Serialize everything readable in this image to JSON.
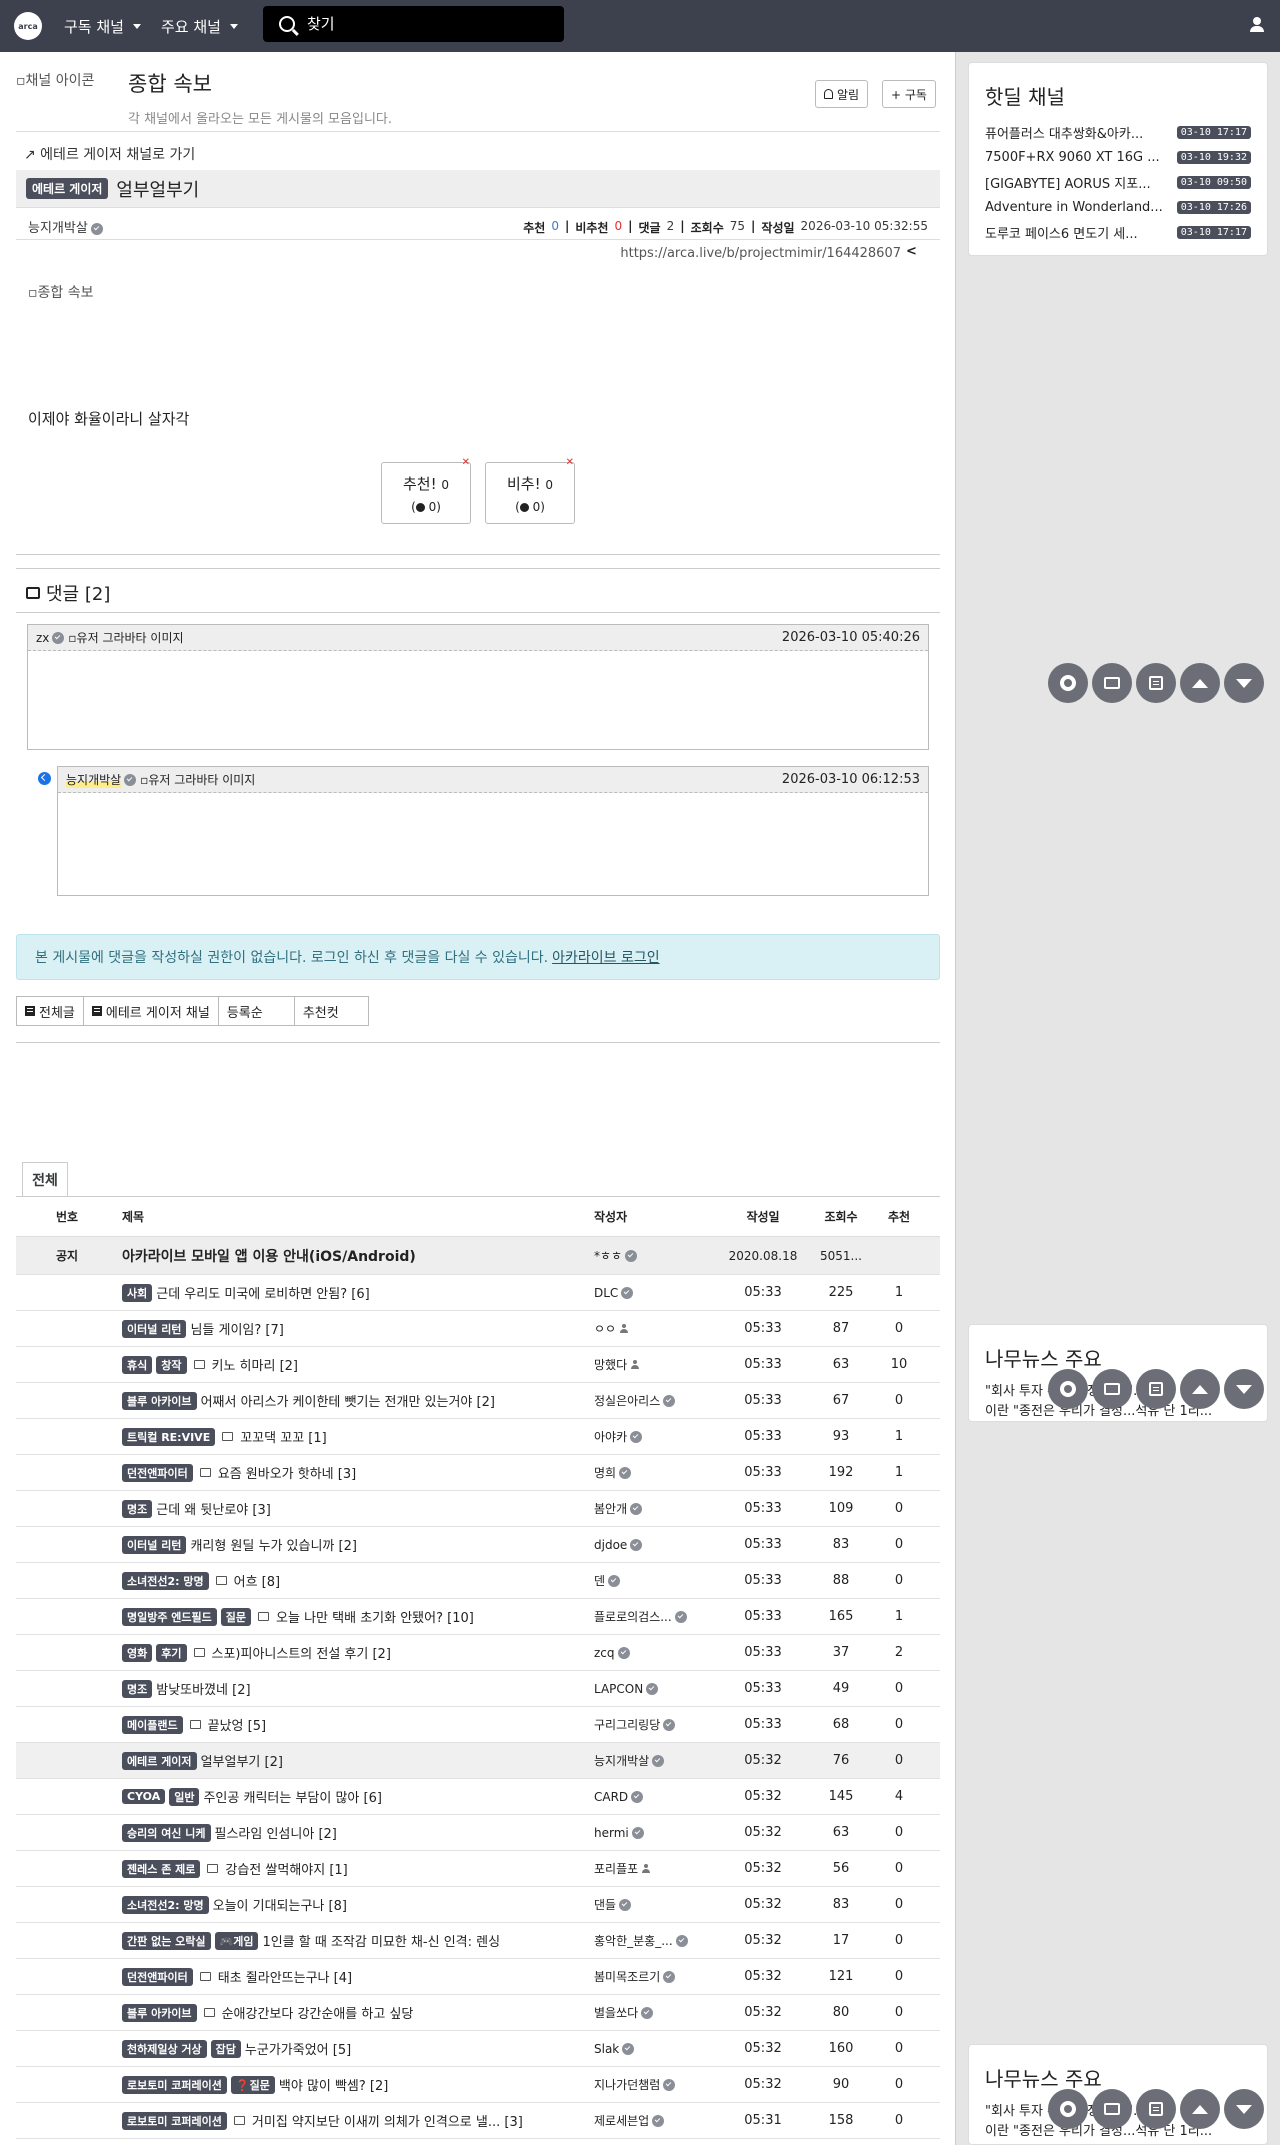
{
  "nav": {
    "logo": "arca",
    "menu1": "구독 채널",
    "menu2": "주요 채널",
    "search_placeholder": "찾기"
  },
  "board": {
    "channel_icon_alt": "채널 아이콘",
    "title": "종합 속보",
    "desc": "각 채널에서 올라오는 모든 게시물의 모음입니다.",
    "alarm_label": "알림",
    "subscribe_label": "+ 구독"
  },
  "article": {
    "goto_link": "↗ 에테르 게이저 채널로 가기",
    "category": "에테르 게이저",
    "title": "얼부얼부기",
    "author": "능지개박살",
    "rec_label": "추천",
    "rec": "0",
    "nonrec_label": "비추천",
    "nonrec": "0",
    "comments_label": "댓글",
    "comments": "2",
    "views_label": "조회수",
    "views": "75",
    "date_label": "작성일",
    "date": "2026-03-10 05:32:55",
    "url": "https://arca.live/b/projectmimir/164428607",
    "image_alt": "종합 속보",
    "text": "이제야 화율이라니 살자각",
    "vote_up_label": "추천!",
    "vote_up": "0",
    "vote_up_sub": "0",
    "vote_down_label": "비추!",
    "vote_down": "0",
    "vote_down_sub": "0"
  },
  "comments": {
    "header": "댓글 [2]",
    "items": [
      {
        "author": "zx",
        "avatar_alt": "유저 그라바타 이미지",
        "date": "2026-03-10 05:40:26"
      },
      {
        "author": "능지개박살",
        "avatar_alt": "유저 그라바타 이미지",
        "date": "2026-03-10 06:12:53"
      }
    ],
    "login_notice": "본 게시물에 댓글을 작성하실 권한이 없습니다. 로그인 하신 후 댓글을 다실 수 있습니다.",
    "login_link": "아카라이브 로그인"
  },
  "filters": {
    "all": "전체글",
    "channel": "에테르 게이저 채널",
    "sort": "등록순",
    "rec_cut": "추천컷"
  },
  "list": {
    "tab": "전체",
    "headers": {
      "no": "번호",
      "title": "제목",
      "author": "작성자",
      "date": "작성일",
      "views": "조회수",
      "rec": "추천"
    },
    "notice": {
      "no": "공지",
      "title": "아카라이브 모바일 앱 이용 안내(iOS/Android)",
      "author": "*ㅎㅎ",
      "date": "2020.08.18",
      "views": "5051...",
      "rec": ""
    },
    "rows": [
      {
        "cats": [
          "사회"
        ],
        "img": false,
        "title": "근데 우리도 미국에 로비하면 안됨? [6]",
        "author": "DLC",
        "verified": true,
        "date": "05:33",
        "views": "225",
        "rec": "1"
      },
      {
        "cats": [
          "이터널 리턴"
        ],
        "img": false,
        "title": "님들 게이임? [7]",
        "author": "ㅇㅇ",
        "verified": false,
        "date": "05:33",
        "views": "87",
        "rec": "0"
      },
      {
        "cats": [
          "휴식",
          "창작"
        ],
        "img": true,
        "title": "키노 히마리 [2]",
        "author": "망했다",
        "verified": false,
        "date": "05:33",
        "views": "63",
        "rec": "10"
      },
      {
        "cats": [
          "블루 아카이브"
        ],
        "img": false,
        "title": "어째서 아리스가 케이한테 뺏기는 전개만 있는거야 [2]",
        "author": "정실은아리스",
        "verified": true,
        "date": "05:33",
        "views": "67",
        "rec": "0"
      },
      {
        "cats": [
          "트릭컬 RE:VIVE"
        ],
        "img": true,
        "title": "꼬꼬댁 꼬꼬 [1]",
        "author": "아야카",
        "verified": true,
        "date": "05:33",
        "views": "93",
        "rec": "1"
      },
      {
        "cats": [
          "던전앤파이터"
        ],
        "img": true,
        "title": "요즘 원바오가 핫하네 [3]",
        "author": "명희",
        "verified": true,
        "date": "05:33",
        "views": "192",
        "rec": "1"
      },
      {
        "cats": [
          "명조"
        ],
        "img": false,
        "title": "근데 왜 뒷난로야 [3]",
        "author": "봄안개",
        "verified": true,
        "date": "05:33",
        "views": "109",
        "rec": "0"
      },
      {
        "cats": [
          "이터널 리턴"
        ],
        "img": false,
        "title": "캐리형 원딜 누가 있습니까 [2]",
        "author": "djdoe",
        "verified": true,
        "date": "05:33",
        "views": "83",
        "rec": "0"
      },
      {
        "cats": [
          "소녀전선2: 망명"
        ],
        "img": true,
        "title": "어흐 [8]",
        "author": "덴",
        "verified": true,
        "date": "05:33",
        "views": "88",
        "rec": "0"
      },
      {
        "cats": [
          "명일방주 엔드필드",
          "질문"
        ],
        "img": true,
        "title": "오늘 나만 택배 초기화 안됐어? [10]",
        "author": "플로로의검스...",
        "verified": true,
        "date": "05:33",
        "views": "165",
        "rec": "1"
      },
      {
        "cats": [
          "영화",
          "후기"
        ],
        "img": true,
        "title": "스포)피아니스트의 전설 후기 [2]",
        "author": "zcq",
        "verified": true,
        "date": "05:33",
        "views": "37",
        "rec": "2"
      },
      {
        "cats": [
          "명조"
        ],
        "img": false,
        "title": "밤낮또바꼈네 [2]",
        "author": "LAPCON",
        "verified": true,
        "date": "05:33",
        "views": "49",
        "rec": "0"
      },
      {
        "cats": [
          "메이플랜드"
        ],
        "img": true,
        "title": "끝났엉 [5]",
        "author": "구리그리링당",
        "verified": true,
        "date": "05:33",
        "views": "68",
        "rec": "0"
      },
      {
        "cats": [
          "에테르 게이저"
        ],
        "img": false,
        "title": "얼부얼부기 [2]",
        "author": "능지개박살",
        "verified": true,
        "date": "05:32",
        "views": "76",
        "rec": "0",
        "current": true
      },
      {
        "cats": [
          "CYOA",
          "일반"
        ],
        "img": false,
        "title": "주인공 캐릭터는 부담이 많아 [6]",
        "author": "CARD",
        "verified": true,
        "date": "05:32",
        "views": "145",
        "rec": "4"
      },
      {
        "cats": [
          "승리의 여신 니케"
        ],
        "img": false,
        "title": "필스라임 인섬니아 [2]",
        "author": "hermi",
        "verified": true,
        "date": "05:32",
        "views": "63",
        "rec": "0"
      },
      {
        "cats": [
          "젠레스 존 제로"
        ],
        "img": true,
        "title": "강습전 쌀먹해야지 [1]",
        "author": "포리플포",
        "verified": false,
        "date": "05:32",
        "views": "56",
        "rec": "0"
      },
      {
        "cats": [
          "소녀전선2: 망명"
        ],
        "img": false,
        "title": "오늘이 기대되는구나 [8]",
        "author": "댄들",
        "verified": true,
        "date": "05:32",
        "views": "83",
        "rec": "0"
      },
      {
        "cats": [
          "간판 없는 오락실",
          "🎮게임"
        ],
        "img": false,
        "title": "1인클 할 때 조작감 미묘한 채-신 인격: 렌싱",
        "author": "홍악한_분홍_...",
        "verified": true,
        "date": "05:32",
        "views": "17",
        "rec": "0"
      },
      {
        "cats": [
          "던전앤파이터"
        ],
        "img": true,
        "title": "태초 쥘라안뜨는구나 [4]",
        "author": "봄미목조르기",
        "verified": true,
        "date": "05:32",
        "views": "121",
        "rec": "0"
      },
      {
        "cats": [
          "블루 아카이브"
        ],
        "img": true,
        "title": "순애강간보다 강간순애를 하고 싶당",
        "author": "별을쏘다",
        "verified": true,
        "date": "05:32",
        "views": "80",
        "rec": "0"
      },
      {
        "cats": [
          "천하제일상 거상",
          "잡담"
        ],
        "img": false,
        "title": "누군가가죽었어 [5]",
        "author": "Slak",
        "verified": true,
        "date": "05:32",
        "views": "160",
        "rec": "0"
      },
      {
        "cats": [
          "로보토미 코퍼레이션",
          "❓질문"
        ],
        "img": false,
        "title": "백야 많이 빡셈? [2]",
        "author": "지나가던챔럼",
        "verified": true,
        "date": "05:32",
        "views": "90",
        "rec": "0"
      },
      {
        "cats": [
          "로보토미 코퍼레이션"
        ],
        "img": true,
        "title": "거미집 약지보단 이새끼 의체가 인격으로 낼... [3]",
        "author": "제로세븐업",
        "verified": true,
        "date": "05:31",
        "views": "158",
        "rec": "0"
      }
    ]
  },
  "sidebar": {
    "hot_title": "핫딜 채널",
    "hot_items": [
      {
        "title": "퓨어플러스 대추쌍화&아카...",
        "time": "03-10 17:17"
      },
      {
        "title": "7500F+RX 9060 XT 16G ...",
        "time": "03-10 19:32"
      },
      {
        "title": "[GIGABYTE] AORUS 지포...",
        "time": "03-10 09:50"
      },
      {
        "title": "Adventure in Wonderland...",
        "time": "03-10 17:26"
      },
      {
        "title": "도루코 페이스6 면도기 세...",
        "time": "03-10 17:17"
      }
    ],
    "news_title": "나무뉴스 주요",
    "news_line1": "\"회사 투자 유치 과정 관여\"...",
    "news_line2": "이란 \"종전은 우리가 결정...석유 단 1리..."
  }
}
